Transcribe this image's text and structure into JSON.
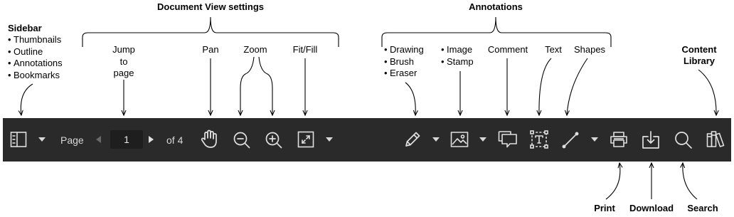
{
  "headings": {
    "document_view": "Document View settings",
    "annotations": "Annotations"
  },
  "sidebar": {
    "title": "Sidebar",
    "items": [
      "Thumbnails",
      "Outline",
      "Annotations",
      "Bookmarks"
    ]
  },
  "labels": {
    "jump_to_page": "Jump to page",
    "pan": "Pan",
    "zoom": "Zoom",
    "fit_fill": "Fit/Fill",
    "comment": "Comment",
    "text": "Text",
    "shapes": "Shapes",
    "content_library": "Content Library",
    "print": "Print",
    "download": "Download",
    "search": "Search"
  },
  "drawing_group": [
    "Drawing",
    "Brush",
    "Eraser"
  ],
  "image_group": [
    "Image",
    "Stamp"
  ],
  "toolbar": {
    "page_label": "Page",
    "page_value": "1",
    "page_total": "of 4",
    "icons": [
      "sidebar-panel-icon",
      "dropdown-caret-icon",
      "previous-page-icon",
      "next-page-icon",
      "hand-pan-icon",
      "zoom-out-icon",
      "zoom-in-icon",
      "fit-fill-icon",
      "pencil-drawing-icon",
      "image-icon",
      "comment-icon",
      "text-box-icon",
      "line-shape-icon",
      "printer-icon",
      "download-icon",
      "search-icon",
      "content-library-icon"
    ]
  },
  "colors": {
    "toolbar_bg": "#2a2a2a",
    "icon": "#e0e0e0",
    "page_input_bg": "#1e1e1e",
    "annotation_ink": "#000000",
    "page_background": "#ffffff"
  }
}
